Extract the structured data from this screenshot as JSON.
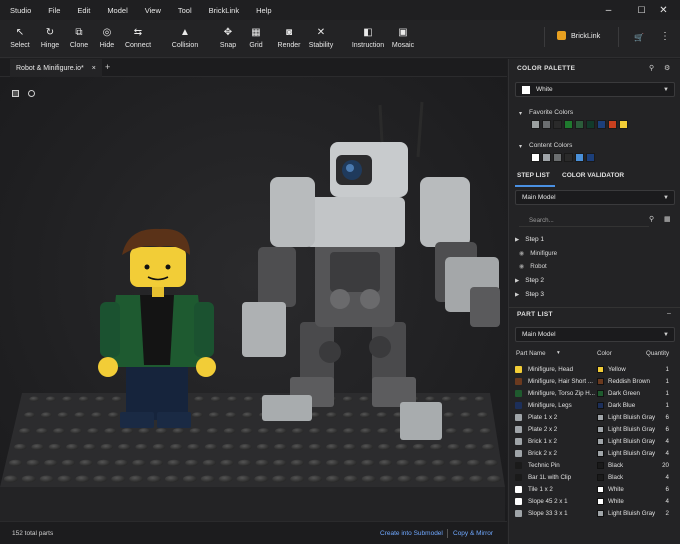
{
  "menu": [
    "Studio",
    "File",
    "Edit",
    "Model",
    "View",
    "Tool",
    "BrickLink",
    "Help"
  ],
  "window_controls": [
    "–",
    "☐",
    "✕"
  ],
  "toolbar": {
    "tools": [
      {
        "name": "select",
        "label": "Select",
        "icon": "↖"
      },
      {
        "name": "hinge",
        "label": "Hinge",
        "icon": "↻"
      },
      {
        "name": "clone",
        "label": "Clone",
        "icon": "⧉"
      },
      {
        "name": "hide",
        "label": "Hide",
        "icon": "◎"
      },
      {
        "name": "connect",
        "label": "Connect",
        "icon": "⇆"
      },
      {
        "name": "collision",
        "label": "Collision",
        "icon": "▲"
      },
      {
        "name": "snap",
        "label": "Snap",
        "icon": "✥"
      },
      {
        "name": "grid",
        "label": "Grid",
        "icon": "▦"
      },
      {
        "name": "render",
        "label": "Render",
        "icon": "◙"
      },
      {
        "name": "stability",
        "label": "Stability",
        "icon": "✕"
      },
      {
        "name": "instruction",
        "label": "Instruction",
        "icon": "◧"
      },
      {
        "name": "mosaic",
        "label": "Mosaic",
        "icon": "▣"
      }
    ],
    "bricklink_label": "BrickLink",
    "cart_icon": "cart-icon",
    "more_icon": "more-icon"
  },
  "tabs": {
    "document_title": "Robot & Minifigure.io*",
    "close_glyph": "×",
    "add_glyph": "+"
  },
  "status": {
    "part_count": "152 total parts",
    "create_submodel": "Create into Submodel",
    "copy_mirror": "Copy & Mirror"
  },
  "color_palette": {
    "title": "COLOR PALETTE",
    "selected_color": "White",
    "selected_hex": "#ffffff",
    "favorite_title": "Favorite Colors",
    "favorite_colors": [
      "#9ba0a0",
      "#6b6e70",
      "#2a2a2a",
      "#1f7a2e",
      "#2b5c3a",
      "#123a2a",
      "#1c3f7a",
      "#c8401f",
      "#f2cd37"
    ],
    "content_title": "Content Colors",
    "content_colors": [
      "#ffffff",
      "#a0a5a9",
      "#6b6e70",
      "#2a2a2a",
      "#4a90d9",
      "#1c3f7a"
    ]
  },
  "step_list": {
    "tab_steps": "STEP LIST",
    "tab_validator": "COLOR VALIDATOR",
    "model": "Main Model",
    "search_placeholder": "Search...",
    "steps": [
      {
        "label": "Step 1"
      },
      {
        "label": "Minifigure"
      },
      {
        "label": "Robot"
      },
      {
        "label": "Step 2"
      },
      {
        "label": "Step 3"
      }
    ]
  },
  "part_list": {
    "title": "PART LIST",
    "model": "Main Model",
    "headers": {
      "name": "Part Name",
      "color": "Color",
      "qty": "Quantity"
    },
    "rows": [
      {
        "name": "Minifigure, Head",
        "color": "Yellow",
        "hex": "#f2cd37",
        "qty": "1"
      },
      {
        "name": "Minifigure, Hair Short ...",
        "color": "Reddish Brown",
        "hex": "#6b3a1f",
        "qty": "1"
      },
      {
        "name": "Minifigure, Torso Zip H...",
        "color": "Dark Green",
        "hex": "#1f5a2e",
        "qty": "1"
      },
      {
        "name": "Minifigure, Legs",
        "color": "Dark Blue",
        "hex": "#1c2f5a",
        "qty": "1"
      },
      {
        "name": "Plate 1 x 2",
        "color": "Light Bluish Gray",
        "hex": "#a0a5a9",
        "qty": "6"
      },
      {
        "name": "Plate 2 x 2",
        "color": "Light Bluish Gray",
        "hex": "#a0a5a9",
        "qty": "6"
      },
      {
        "name": "Brick 1 x 2",
        "color": "Light Bluish Gray",
        "hex": "#a0a5a9",
        "qty": "4"
      },
      {
        "name": "Brick 2 x 2",
        "color": "Light Bluish Gray",
        "hex": "#a0a5a9",
        "qty": "4"
      },
      {
        "name": "Technic Pin",
        "color": "Black",
        "hex": "#1a1a1a",
        "qty": "20"
      },
      {
        "name": "Bar 1L with Clip",
        "color": "Black",
        "hex": "#1a1a1a",
        "qty": "4"
      },
      {
        "name": "Tile 1 x 2",
        "color": "White",
        "hex": "#ffffff",
        "qty": "6"
      },
      {
        "name": "Slope 45 2 x 1",
        "color": "White",
        "hex": "#ffffff",
        "qty": "4"
      },
      {
        "name": "Slope 33 3 x 1",
        "color": "Light Bluish Gray",
        "hex": "#a0a5a9",
        "qty": "2"
      }
    ]
  }
}
